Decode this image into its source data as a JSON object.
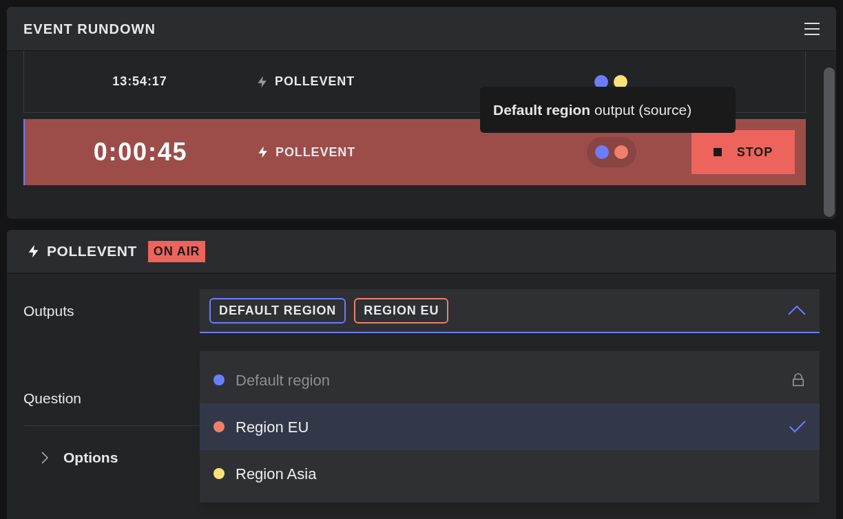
{
  "rundown": {
    "title": "EVENT RUNDOWN",
    "rows": [
      {
        "time": "13:54:17",
        "name": "POLLEVENT",
        "active": false,
        "dots": [
          {
            "color": "#6b7dfa"
          },
          {
            "color": "#f9e27a"
          }
        ]
      },
      {
        "time": "0:00:45",
        "name": "POLLEVENT",
        "active": true,
        "dots": [
          {
            "color": "#6b7dfa"
          },
          {
            "color": "#f0806c"
          }
        ],
        "button": "STOP"
      }
    ],
    "tooltip": "**Default region** output (source)"
  },
  "detail": {
    "title": "POLLEVENT",
    "badge": "ON AIR",
    "outputs": {
      "label": "Outputs",
      "expanded": true,
      "chips": [
        {
          "label": "DEFAULT REGION",
          "color": "#6b7dfa"
        },
        {
          "label": "REGION EU",
          "color": "#f0806c"
        }
      ],
      "options": [
        {
          "label": "Default region",
          "color": "#6b7dfa",
          "locked": true,
          "selected": false
        },
        {
          "label": "Region EU",
          "color": "#f0806c",
          "locked": false,
          "selected": true
        },
        {
          "label": "Region Asia",
          "color": "#f9e27a",
          "locked": false,
          "selected": false
        }
      ]
    },
    "question": {
      "label": "Question"
    },
    "options_section": {
      "label": "Options",
      "expanded": false
    }
  }
}
